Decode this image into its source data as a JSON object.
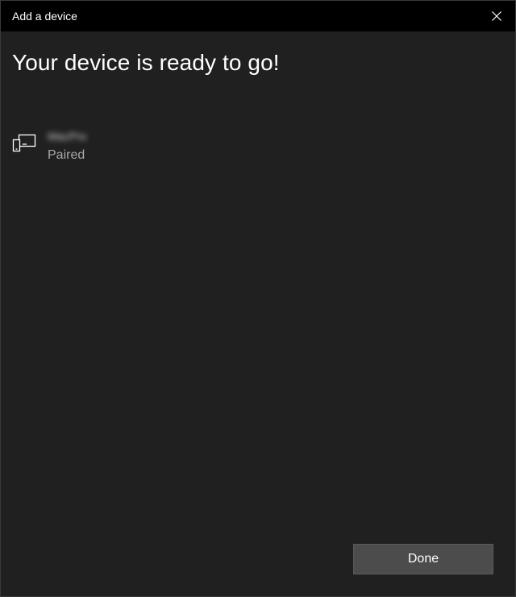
{
  "window": {
    "title": "Add a device"
  },
  "main": {
    "heading": "Your device is ready to go!",
    "device": {
      "name": "MacPro",
      "status": "Paired",
      "icon": "phone-device-icon"
    }
  },
  "footer": {
    "done_label": "Done"
  },
  "colors": {
    "background": "#202020",
    "titlebar": "#000000",
    "button": "#4c4c4c",
    "secondary_text": "#a8a8a8"
  }
}
